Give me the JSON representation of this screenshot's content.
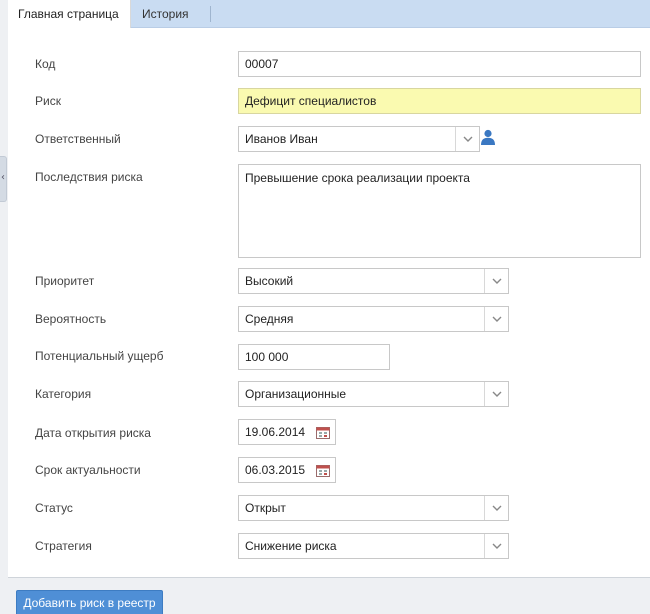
{
  "tabs": {
    "main": "Главная страница",
    "history": "История"
  },
  "form": {
    "code": {
      "label": "Код",
      "value": "00007"
    },
    "risk": {
      "label": "Риск",
      "value": "Дефицит специалистов"
    },
    "responsible": {
      "label": "Ответственный",
      "value": "Иванов Иван"
    },
    "consequences": {
      "label": "Последствия риска",
      "value": "Превышение срока реализации проекта"
    },
    "priority": {
      "label": "Приоритет",
      "value": "Высокий"
    },
    "probability": {
      "label": "Вероятность",
      "value": "Средняя"
    },
    "damage": {
      "label": "Потенциальный ущерб",
      "value": "100 000"
    },
    "category": {
      "label": "Категория",
      "value": "Организационные"
    },
    "open_date": {
      "label": "Дата открытия риска",
      "value": "19.06.2014"
    },
    "relevance_date": {
      "label": "Срок актуальности",
      "value": "06.03.2015"
    },
    "status": {
      "label": "Статус",
      "value": "Открыт"
    },
    "strategy": {
      "label": "Стратегия",
      "value": "Снижение риска"
    }
  },
  "actions": {
    "add_label": "Добавить риск в реестр"
  },
  "icons": {
    "dropdown": "chevron-down-icon",
    "calendar": "calendar-icon",
    "user": "user-icon",
    "collapse": "collapse-left-icon"
  },
  "colors": {
    "tabbar": "#c9dcf2",
    "highlight": "#fafab0",
    "primary_button": "#4f8fd6",
    "user_icon": "#3a78c2"
  }
}
